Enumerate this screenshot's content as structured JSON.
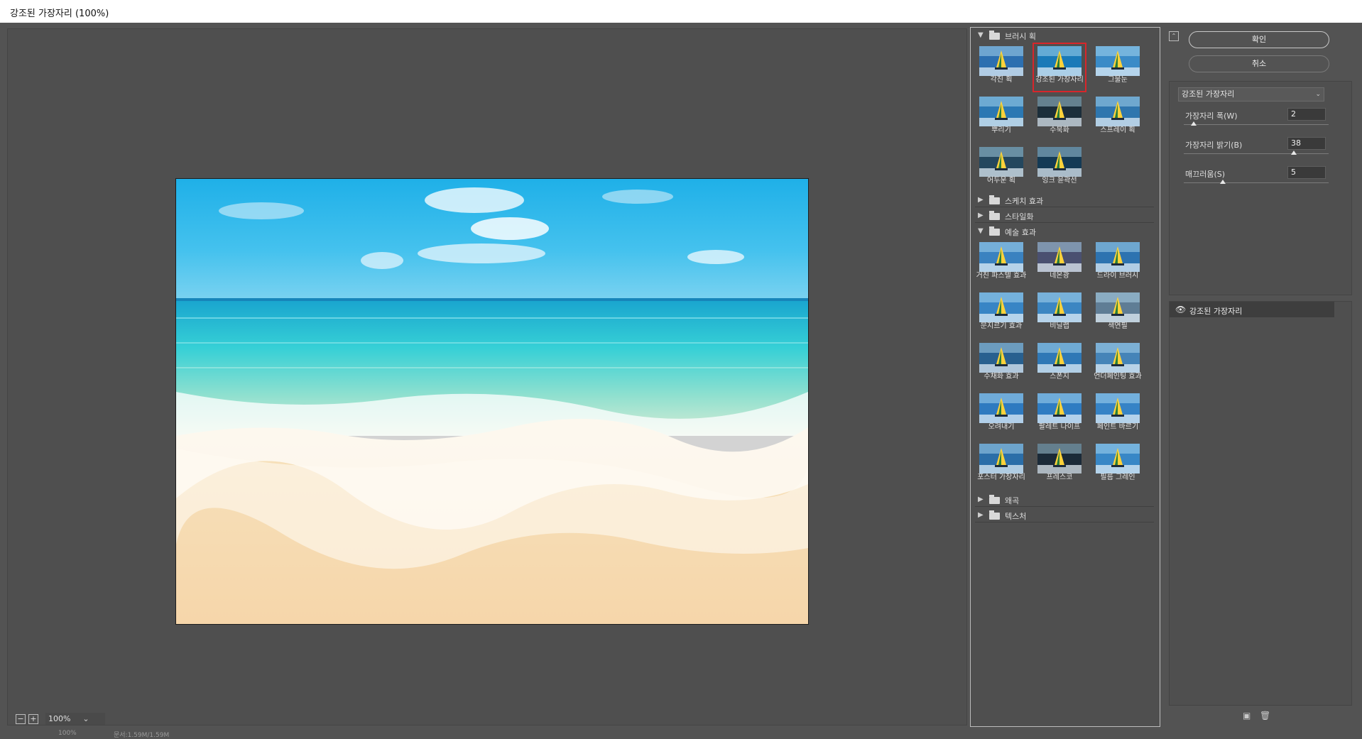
{
  "window": {
    "title": "강조된 가장자리 (100%)"
  },
  "preview": {
    "zoom_value": "100%",
    "zoom_out_icon": "zoom-out-icon",
    "zoom_in_icon": "zoom-in-icon",
    "status_zoom": "100%",
    "status_doc": "문서:1.59M/1.59M"
  },
  "gallery": {
    "brush_strokes": {
      "label": "브러시 획",
      "items": [
        {
          "label": "각진 획",
          "tint": "#2c6fb0"
        },
        {
          "label": "강조된 가장자리",
          "tint": "#1a7ab8",
          "selected": true
        },
        {
          "label": "그물눈",
          "tint": "#3a8bc7"
        },
        {
          "label": "뿌리기",
          "tint": "#2b78b3"
        },
        {
          "label": "수묵화",
          "tint": "#1c2e3a"
        },
        {
          "label": "스프레이 획",
          "tint": "#2f76ae"
        },
        {
          "label": "어두운 획",
          "tint": "#24475e"
        },
        {
          "label": "잉크 윤곽선",
          "tint": "#143a55"
        }
      ]
    },
    "sketch": {
      "label": "스케치 효과"
    },
    "stylize": {
      "label": "스타일화"
    },
    "artistic": {
      "label": "예술 효과",
      "items": [
        {
          "label": "거친 파스텔 효과",
          "tint": "#3a82c0"
        },
        {
          "label": "네온광",
          "tint": "#4a5070"
        },
        {
          "label": "드라이 브러시",
          "tint": "#2d73b0"
        },
        {
          "label": "문지르기 효과",
          "tint": "#3885c5"
        },
        {
          "label": "비닐랩",
          "tint": "#3c86c2"
        },
        {
          "label": "색연필",
          "tint": "#5f7d95"
        },
        {
          "label": "수채화 효과",
          "tint": "#28608f"
        },
        {
          "label": "스폰지",
          "tint": "#2f78b6"
        },
        {
          "label": "언더페인팅 효과",
          "tint": "#4584b8"
        },
        {
          "label": "오려내기",
          "tint": "#2e7ac0"
        },
        {
          "label": "팔레트 나이프",
          "tint": "#2f7cc2"
        },
        {
          "label": "페인트 바르기",
          "tint": "#3683c6"
        },
        {
          "label": "포스터 가장자리",
          "tint": "#2b6ea8"
        },
        {
          "label": "프레스코",
          "tint": "#1b2a38"
        },
        {
          "label": "필름 그레인",
          "tint": "#3887c6"
        }
      ]
    },
    "distort": {
      "label": "왜곡"
    },
    "texture": {
      "label": "텍스처"
    }
  },
  "controls": {
    "ok_label": "확인",
    "cancel_label": "취소",
    "collapse_icon": "collapse-icon",
    "filter_select": "강조된 가장자리",
    "params": [
      {
        "label": "가장자리 폭(W)",
        "value": "2",
        "fraction": 0.07
      },
      {
        "label": "가장자리 밝기(B)",
        "value": "38",
        "fraction": 0.76
      },
      {
        "label": "매끄러움(S)",
        "value": "5",
        "fraction": 0.27
      }
    ]
  },
  "layers": {
    "items": [
      {
        "name": "강조된 가장자리",
        "visible": true
      }
    ],
    "eye_icon": "eye-icon",
    "new_icon": "new-layer-icon",
    "delete_icon": "trash-icon"
  }
}
